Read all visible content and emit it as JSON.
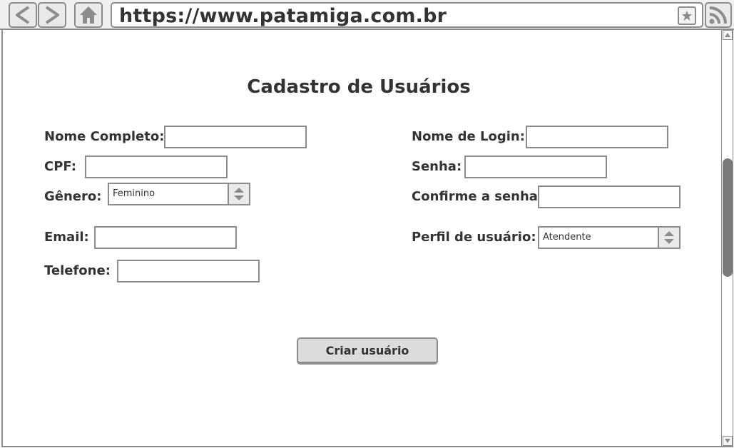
{
  "browser": {
    "url": "https://www.patamiga.com.br",
    "back_icon": "chevron-left-icon",
    "forward_icon": "chevron-right-icon",
    "home_icon": "home-icon",
    "bookmark_icon": "star-icon",
    "feed_icon": "rss-icon"
  },
  "form": {
    "title": "Cadastro de Usuários",
    "left": {
      "nome_completo_label": "Nome Completo:",
      "cpf_label": "CPF:",
      "genero_label": "Gênero:",
      "genero_value": "Feminino",
      "email_label": "Email:",
      "telefone_label": "Telefone:"
    },
    "right": {
      "login_label": "Nome de Login:",
      "senha_label": "Senha:",
      "confirme_label": "Confirme a senha:",
      "perfil_label": "Perfil de usuário:",
      "perfil_value": "Atendente"
    },
    "submit_label": "Criar usuário"
  },
  "colors": {
    "border": "#8c8c8c",
    "text": "#333333",
    "button_bg": "#dcdcdc",
    "scroll_thumb": "#7a7a7a"
  }
}
